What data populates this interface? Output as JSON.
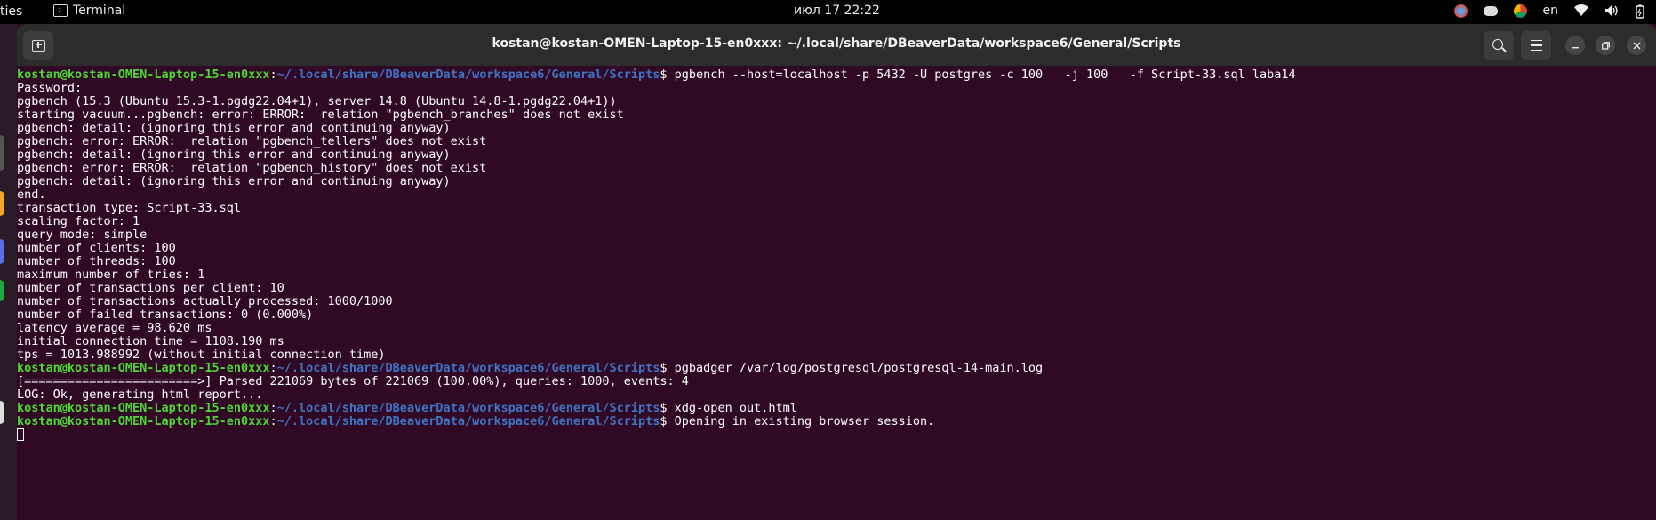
{
  "topbar": {
    "activities": "ties",
    "app_name": "Terminal",
    "clock": "июл 17  22:22",
    "lang": "en"
  },
  "window": {
    "title": "kostan@kostan-OMEN-Laptop-15-en0xxx: ~/.local/share/DBeaverData/workspace6/General/Scripts"
  },
  "terminal": {
    "prompt_user": "kostan@kostan-OMEN-Laptop-15-en0xxx",
    "prompt_path": "~/.local/share/DBeaverData/workspace6/General/Scripts",
    "lines": [
      {
        "type": "prompt",
        "cmd": "pgbench --host=localhost -p 5432 -U postgres -c 100   -j 100   -f Script-33.sql laba14"
      },
      {
        "type": "out",
        "text": "Password:"
      },
      {
        "type": "out",
        "text": "pgbench (15.3 (Ubuntu 15.3-1.pgdg22.04+1), server 14.8 (Ubuntu 14.8-1.pgdg22.04+1))"
      },
      {
        "type": "out",
        "text": "starting vacuum...pgbench: error: ERROR:  relation \"pgbench_branches\" does not exist"
      },
      {
        "type": "out",
        "text": "pgbench: detail: (ignoring this error and continuing anyway)"
      },
      {
        "type": "out",
        "text": "pgbench: error: ERROR:  relation \"pgbench_tellers\" does not exist"
      },
      {
        "type": "out",
        "text": "pgbench: detail: (ignoring this error and continuing anyway)"
      },
      {
        "type": "out",
        "text": "pgbench: error: ERROR:  relation \"pgbench_history\" does not exist"
      },
      {
        "type": "out",
        "text": "pgbench: detail: (ignoring this error and continuing anyway)"
      },
      {
        "type": "out",
        "text": "end."
      },
      {
        "type": "out",
        "text": "transaction type: Script-33.sql"
      },
      {
        "type": "out",
        "text": "scaling factor: 1"
      },
      {
        "type": "out",
        "text": "query mode: simple"
      },
      {
        "type": "out",
        "text": "number of clients: 100"
      },
      {
        "type": "out",
        "text": "number of threads: 100"
      },
      {
        "type": "out",
        "text": "maximum number of tries: 1"
      },
      {
        "type": "out",
        "text": "number of transactions per client: 10"
      },
      {
        "type": "out",
        "text": "number of transactions actually processed: 1000/1000"
      },
      {
        "type": "out",
        "text": "number of failed transactions: 0 (0.000%)"
      },
      {
        "type": "out",
        "text": "latency average = 98.620 ms"
      },
      {
        "type": "out",
        "text": "initial connection time = 1108.190 ms"
      },
      {
        "type": "out",
        "text": "tps = 1013.988992 (without initial connection time)"
      },
      {
        "type": "prompt",
        "cmd": "pgbadger /var/log/postgresql/postgresql-14-main.log"
      },
      {
        "type": "out",
        "text": "[========================>] Parsed 221069 bytes of 221069 (100.00%), queries: 1000, events: 4"
      },
      {
        "type": "out",
        "text": "LOG: Ok, generating html report..."
      },
      {
        "type": "prompt",
        "cmd": "xdg-open out.html"
      },
      {
        "type": "prompt",
        "cmd": "Opening in existing browser session."
      },
      {
        "type": "cursor"
      }
    ]
  },
  "colors": {
    "terminal_bg": "#300a24",
    "prompt_user": "#4ed734",
    "prompt_path": "#3f74c5",
    "titlebar_bg": "#2c2c2c"
  },
  "icons": [
    "terminal-icon",
    "new-tab-icon",
    "search-icon",
    "menu-icon",
    "minimize-icon",
    "maximize-icon",
    "close-icon",
    "wifi-icon",
    "volume-icon",
    "battery-icon",
    "discord-icon",
    "chrome-icon"
  ]
}
